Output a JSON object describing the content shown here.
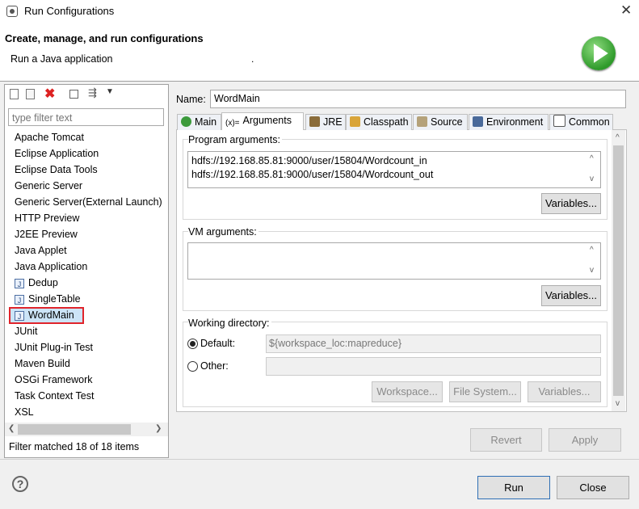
{
  "window": {
    "title": "Run Configurations"
  },
  "header": {
    "title": "Create, manage, and run configurations",
    "subtitle": "Run a Java application",
    "dot": "."
  },
  "sidebar": {
    "filter_placeholder": "type filter text",
    "items": [
      {
        "label": "Apache Tomcat"
      },
      {
        "label": "Eclipse Application"
      },
      {
        "label": "Eclipse Data Tools"
      },
      {
        "label": "Generic Server"
      },
      {
        "label": "Generic Server(External Launch)"
      },
      {
        "label": "HTTP Preview"
      },
      {
        "label": "J2EE Preview"
      },
      {
        "label": "Java Applet"
      },
      {
        "label": "Java Application"
      },
      {
        "label": "Dedup"
      },
      {
        "label": "SingleTable"
      },
      {
        "label": "WordMain"
      },
      {
        "label": "JUnit"
      },
      {
        "label": "JUnit Plug-in Test"
      },
      {
        "label": "Maven Build"
      },
      {
        "label": "OSGi Framework"
      },
      {
        "label": "Task Context Test"
      },
      {
        "label": "XSL"
      }
    ],
    "status": "Filter matched 18 of 18 items"
  },
  "form": {
    "name_label": "Name:",
    "name_value": "WordMain",
    "tabs": [
      {
        "label": "Main"
      },
      {
        "label": "Arguments"
      },
      {
        "label": "JRE"
      },
      {
        "label": "Classpath"
      },
      {
        "label": "Source"
      },
      {
        "label": "Environment"
      },
      {
        "label": "Common"
      }
    ],
    "program_args_label": "Program arguments:",
    "program_args_lines": [
      "hdfs://192.168.85.81:9000/user/15804/Wordcount_in",
      "hdfs://192.168.85.81:9000/user/15804/Wordcount_out"
    ],
    "variables_label": "Variables...",
    "vm_args_label": "VM arguments:",
    "vm_args_value": "",
    "working_dir_label": "Working directory:",
    "default_label": "Default:",
    "default_value": "${workspace_loc:mapreduce}",
    "other_label": "Other:",
    "other_value": "",
    "workspace_btn": "Workspace...",
    "filesystem_btn": "File System...",
    "variables_btn": "Variables..."
  },
  "buttons": {
    "revert": "Revert",
    "apply": "Apply",
    "run": "Run",
    "close": "Close",
    "help": "?"
  },
  "colors": {
    "selection_border": "#e0242b",
    "run_icon": "#3aa52f",
    "default_button_border": "#2f6fb5"
  }
}
